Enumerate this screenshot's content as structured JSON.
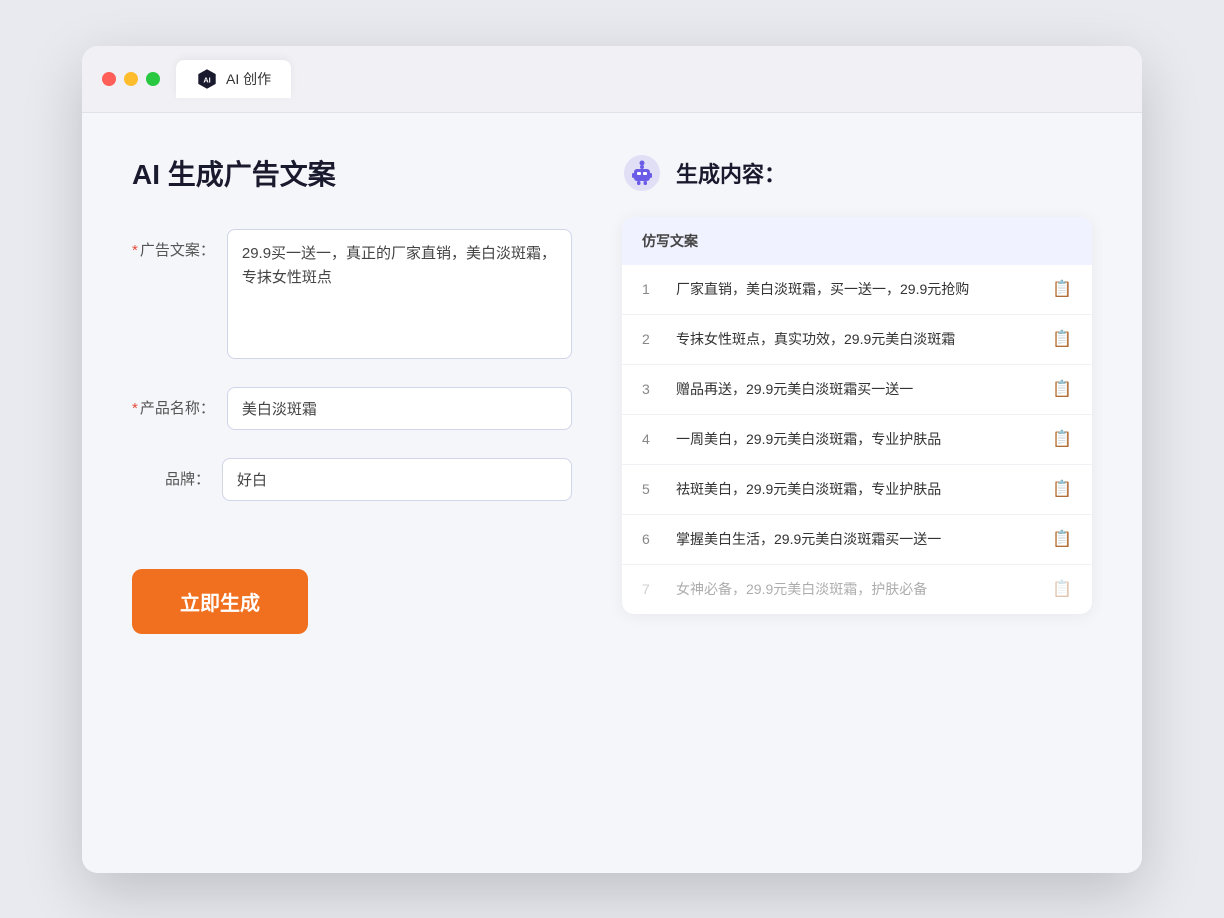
{
  "browser": {
    "tab_label": "AI 创作"
  },
  "page": {
    "title": "AI 生成广告文案",
    "results_title": "生成内容："
  },
  "form": {
    "ad_label": "广告文案：",
    "ad_required": "*",
    "ad_value": "29.9买一送一，真正的厂家直销，美白淡斑霜，专抹女性斑点",
    "product_label": "产品名称：",
    "product_required": "*",
    "product_value": "美白淡斑霜",
    "brand_label": "品牌：",
    "brand_value": "好白",
    "generate_btn": "立即生成"
  },
  "results": {
    "column_header": "仿写文案",
    "rows": [
      {
        "num": 1,
        "text": "厂家直销，美白淡斑霜，买一送一，29.9元抢购"
      },
      {
        "num": 2,
        "text": "专抹女性斑点，真实功效，29.9元美白淡斑霜"
      },
      {
        "num": 3,
        "text": "赠品再送，29.9元美白淡斑霜买一送一"
      },
      {
        "num": 4,
        "text": "一周美白，29.9元美白淡斑霜，专业护肤品"
      },
      {
        "num": 5,
        "text": "祛斑美白，29.9元美白淡斑霜，专业护肤品"
      },
      {
        "num": 6,
        "text": "掌握美白生活，29.9元美白淡斑霜买一送一"
      },
      {
        "num": 7,
        "text": "女神必备，29.9元美白淡斑霜，护肤必备",
        "faded": true
      }
    ]
  }
}
